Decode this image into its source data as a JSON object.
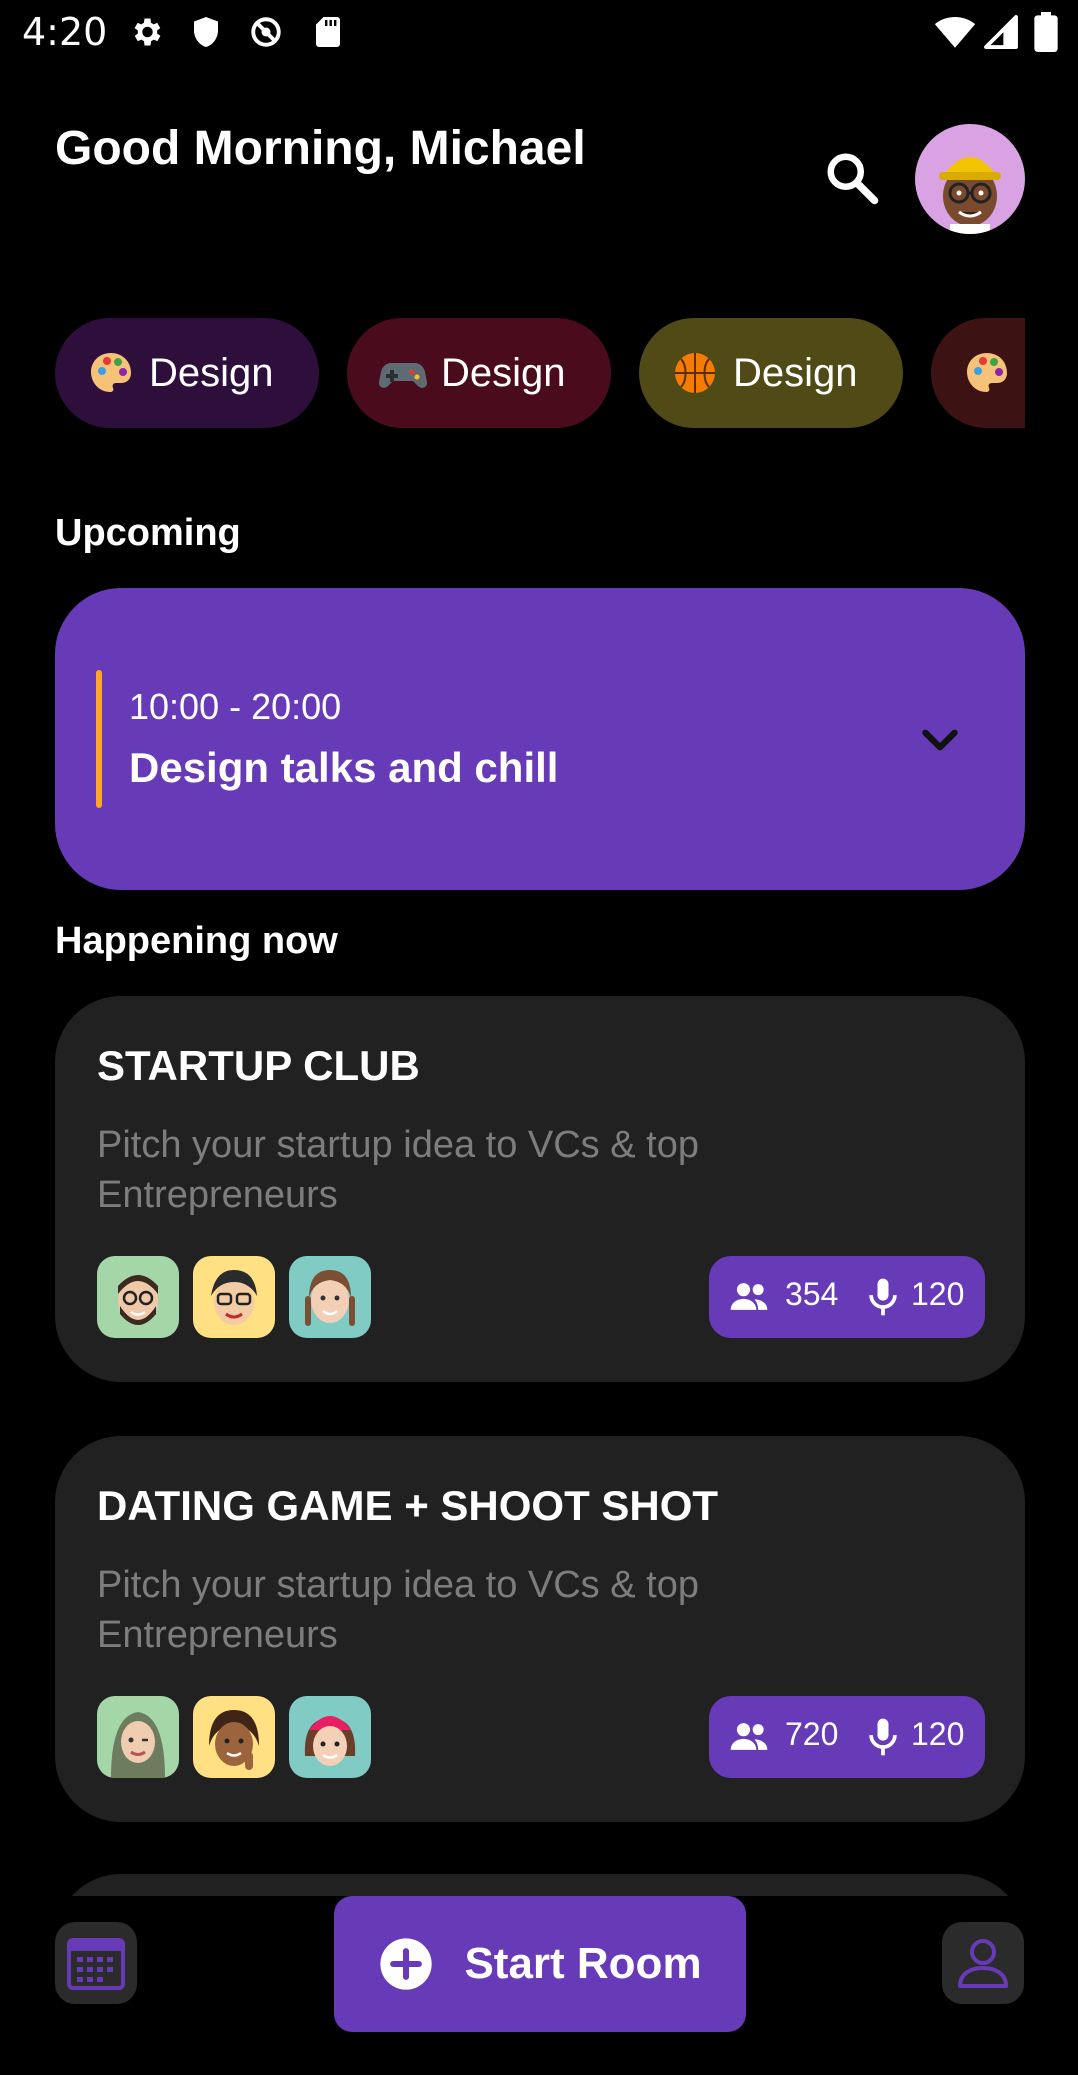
{
  "status_bar": {
    "time": "4:20",
    "icons": [
      "gear-icon",
      "shield-icon",
      "data-saver-icon",
      "sd-card-icon",
      "wifi-icon",
      "signal-icon",
      "battery-icon"
    ]
  },
  "header": {
    "greeting": "Good Morning, Michael",
    "icons": [
      "search-icon",
      "avatar-memoji"
    ]
  },
  "categories": [
    {
      "label": "Design",
      "icon": "palette-emoji",
      "color": "#2e0e3b"
    },
    {
      "label": "Design",
      "icon": "gamepad-emoji",
      "color": "#4a0c1c"
    },
    {
      "label": "Design",
      "icon": "basketball-emoji",
      "color": "#4f4a16"
    },
    {
      "label": "",
      "icon": "palette-emoji",
      "color": "#3d1212"
    }
  ],
  "upcoming": {
    "section_title": "Upcoming",
    "time_range": "10:00 - 20:00",
    "title": "Design talks and chill",
    "accent": "#ffa726"
  },
  "happening": {
    "section_title": "Happening now",
    "rooms": [
      {
        "title": "STARTUP CLUB",
        "description": "Pitch your startup idea to VCs & top Entrepreneurs",
        "listeners": "354",
        "speakers": "120",
        "avatar_colors": [
          "#a5d6a7",
          "#ffe082",
          "#80cbc4"
        ]
      },
      {
        "title": "DATING GAME + SHOOT SHOT",
        "description": "Pitch your startup idea to VCs & top Entrepreneurs",
        "listeners": "720",
        "speakers": "120",
        "avatar_colors": [
          "#a5d6a7",
          "#ffe082",
          "#80cbc4"
        ]
      }
    ]
  },
  "bottom_bar": {
    "start_room_label": "Start Room",
    "icons": [
      "calendar-icon",
      "plus-circle-icon",
      "profile-icon"
    ]
  },
  "colors": {
    "accent": "#673ab7",
    "card_bg": "#212121",
    "muted_text": "#7d7d7d"
  }
}
